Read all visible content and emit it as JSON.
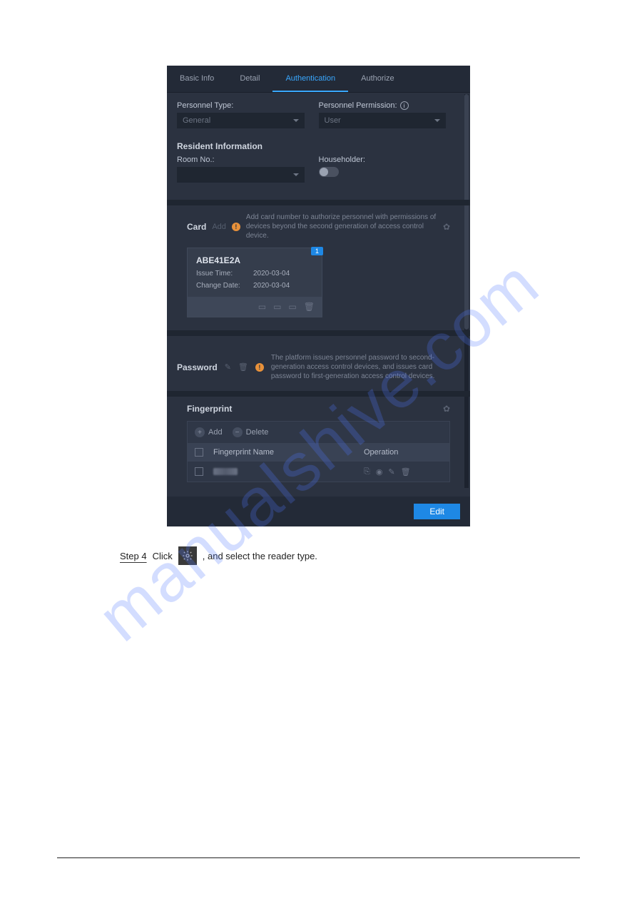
{
  "watermark": "manualshive.com",
  "tabs": {
    "basic_info": "Basic Info",
    "detail": "Detail",
    "authentication": "Authentication",
    "authorize": "Authorize"
  },
  "form": {
    "personnel_type_label": "Personnel Type:",
    "personnel_type_value": "General",
    "personnel_permission_label": "Personnel Permission:",
    "personnel_permission_value": "User",
    "resident_info_title": "Resident Information",
    "room_no_label": "Room No.:",
    "room_no_value": "",
    "householder_label": "Householder:"
  },
  "card": {
    "title": "Card",
    "add": "Add",
    "note": "Add card number to authorize personnel with permissions of devices beyond the second generation of access control device.",
    "badge": "1",
    "id": "ABE41E2A",
    "issue_time_label": "Issue Time:",
    "issue_time_value": "2020-03-04",
    "change_date_label": "Change Date:",
    "change_date_value": "2020-03-04"
  },
  "password": {
    "title": "Password",
    "note": "The platform issues personnel password to second-generation access control devices, and issues card password to first-generation access control devices."
  },
  "fingerprint": {
    "title": "Fingerprint",
    "add": "Add",
    "delete": "Delete",
    "col_name": "Fingerprint Name",
    "col_op": "Operation"
  },
  "footer": {
    "edit": "Edit"
  },
  "doc": {
    "step_prefix": "Step 4",
    "step_text_a": "Click",
    "step_text_b": ", and select the reader type."
  }
}
